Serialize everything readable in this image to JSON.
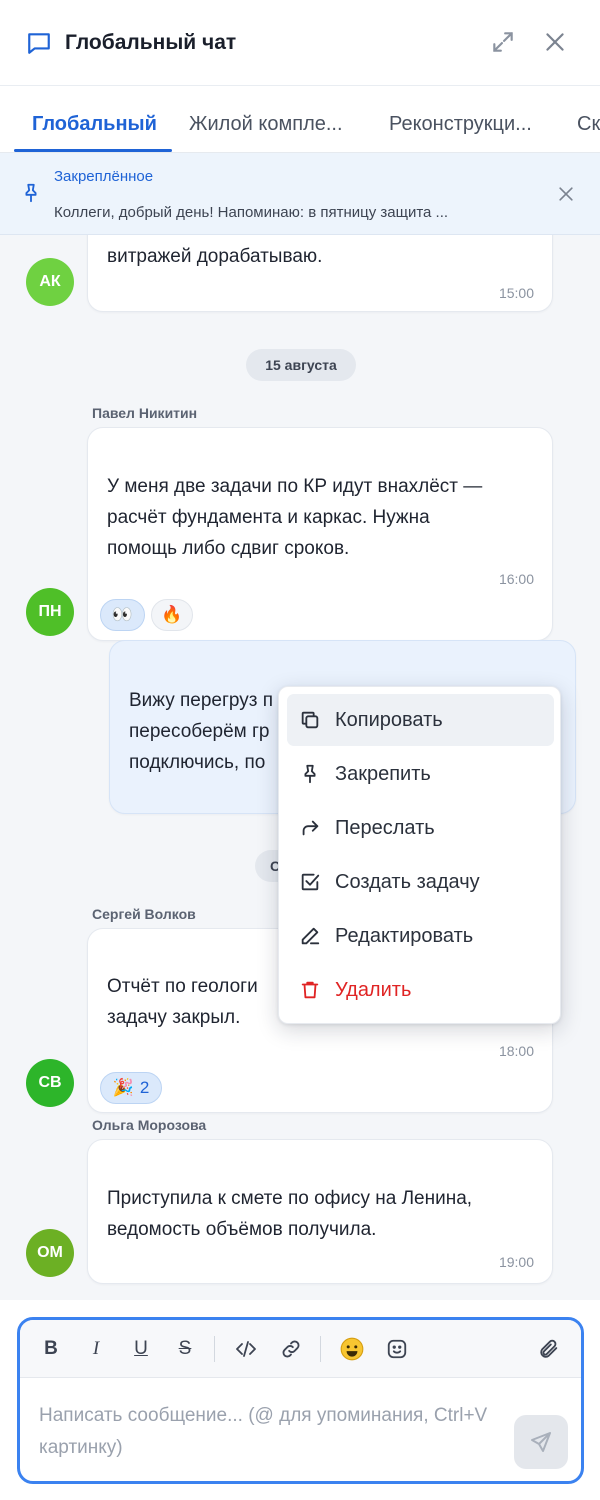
{
  "header": {
    "title": "Глобальный чат"
  },
  "tabs": [
    {
      "label": "Глобальный"
    },
    {
      "label": "Жилой компле..."
    },
    {
      "label": "Реконструкци..."
    },
    {
      "label": "Ск"
    }
  ],
  "pinned": {
    "title": "Закреплённое",
    "text": "Коллеги, добрый день! Напоминаю: в пятницу защита ..."
  },
  "messages": [
    {
      "author_initials": "АК",
      "text_lines": [
        "витражей дорабатываю."
      ],
      "time": "15:00"
    },
    {
      "sender": "Павел Никитин",
      "author_initials": "ПН",
      "text_lines": [
        "У меня две задачи по КР идут внахлёст —",
        "расчёт фундамента и каркас. Нужна",
        "помощь либо сдвиг сроков."
      ],
      "time": "16:00",
      "reactions": [
        {
          "emoji": "👀",
          "count": ""
        },
        {
          "emoji": "🔥",
          "count": ""
        }
      ]
    },
    {
      "mine": true,
      "text_lines": [
        "Вижу перегруз п",
        "пересоберём гр",
        "подключись, по"
      ]
    },
    {
      "sender": "Сергей Волков",
      "author_initials": "СВ",
      "text_lines": [
        "Отчёт по геологи",
        "задачу закрыл."
      ],
      "time": "18:00",
      "reactions": [
        {
          "emoji": "🎉",
          "count": "2"
        }
      ]
    },
    {
      "sender": "Ольга Морозова",
      "author_initials": "ОМ",
      "text_lines": [
        "Приступила к смете по офису на Ленина,",
        "ведомость объёмов получила."
      ],
      "time": "19:00"
    }
  ],
  "dates": [
    "15 августа",
    "С"
  ],
  "context_menu": [
    {
      "label": "Копировать",
      "icon": "copy-icon"
    },
    {
      "label": "Закрепить",
      "icon": "pin-icon"
    },
    {
      "label": "Переслать",
      "icon": "forward-icon"
    },
    {
      "label": "Создать задачу",
      "icon": "checkbox-icon"
    },
    {
      "label": "Редактировать",
      "icon": "pencil-icon"
    },
    {
      "label": "Удалить",
      "icon": "trash-icon"
    }
  ],
  "composer": {
    "placeholder": "Написать сообщение... (@ для упоминания, Ctrl+V картинку)",
    "toolbar": {
      "bold": "B",
      "italic": "I",
      "underline": "U",
      "strike": "S"
    }
  },
  "colors": {
    "accent": "#1f63d6",
    "focus_border": "#3b82f0",
    "danger": "#e02424",
    "avatar_ak": "#6fd141",
    "avatar_pn": "#4fbf28",
    "avatar_sv": "#2db52a",
    "avatar_om": "#6cb024"
  }
}
